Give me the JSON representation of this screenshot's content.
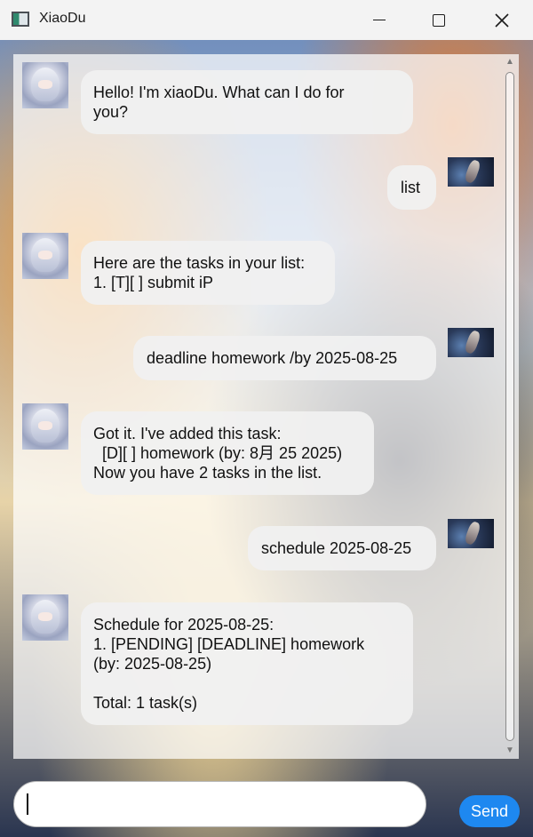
{
  "window": {
    "title": "XiaoDu"
  },
  "messages": [
    {
      "sender": "bot",
      "text": "Hello! I'm xiaoDu. What can I do for\nyou?"
    },
    {
      "sender": "user",
      "text": "list"
    },
    {
      "sender": "bot",
      "text": "Here are the tasks in your list:\n1. [T][ ] submit iP"
    },
    {
      "sender": "user",
      "text": "deadline homework /by 2025-08-25"
    },
    {
      "sender": "bot",
      "text": "Got it. I've added this task:\n  [D][ ] homework (by: 8月 25 2025)\nNow you have 2 tasks in the list."
    },
    {
      "sender": "user",
      "text": "schedule 2025-08-25"
    },
    {
      "sender": "bot",
      "text": "Schedule for 2025-08-25:\n1. [PENDING] [DEADLINE] homework\n(by: 2025-08-25)\n\nTotal: 1 task(s)"
    }
  ],
  "input": {
    "value": "",
    "placeholder": ""
  },
  "send_button": {
    "label": "Send"
  },
  "colors": {
    "send_button": "#1e88f0",
    "bubble": "#f0f0f0",
    "titlebar": "#f3f3f3"
  }
}
